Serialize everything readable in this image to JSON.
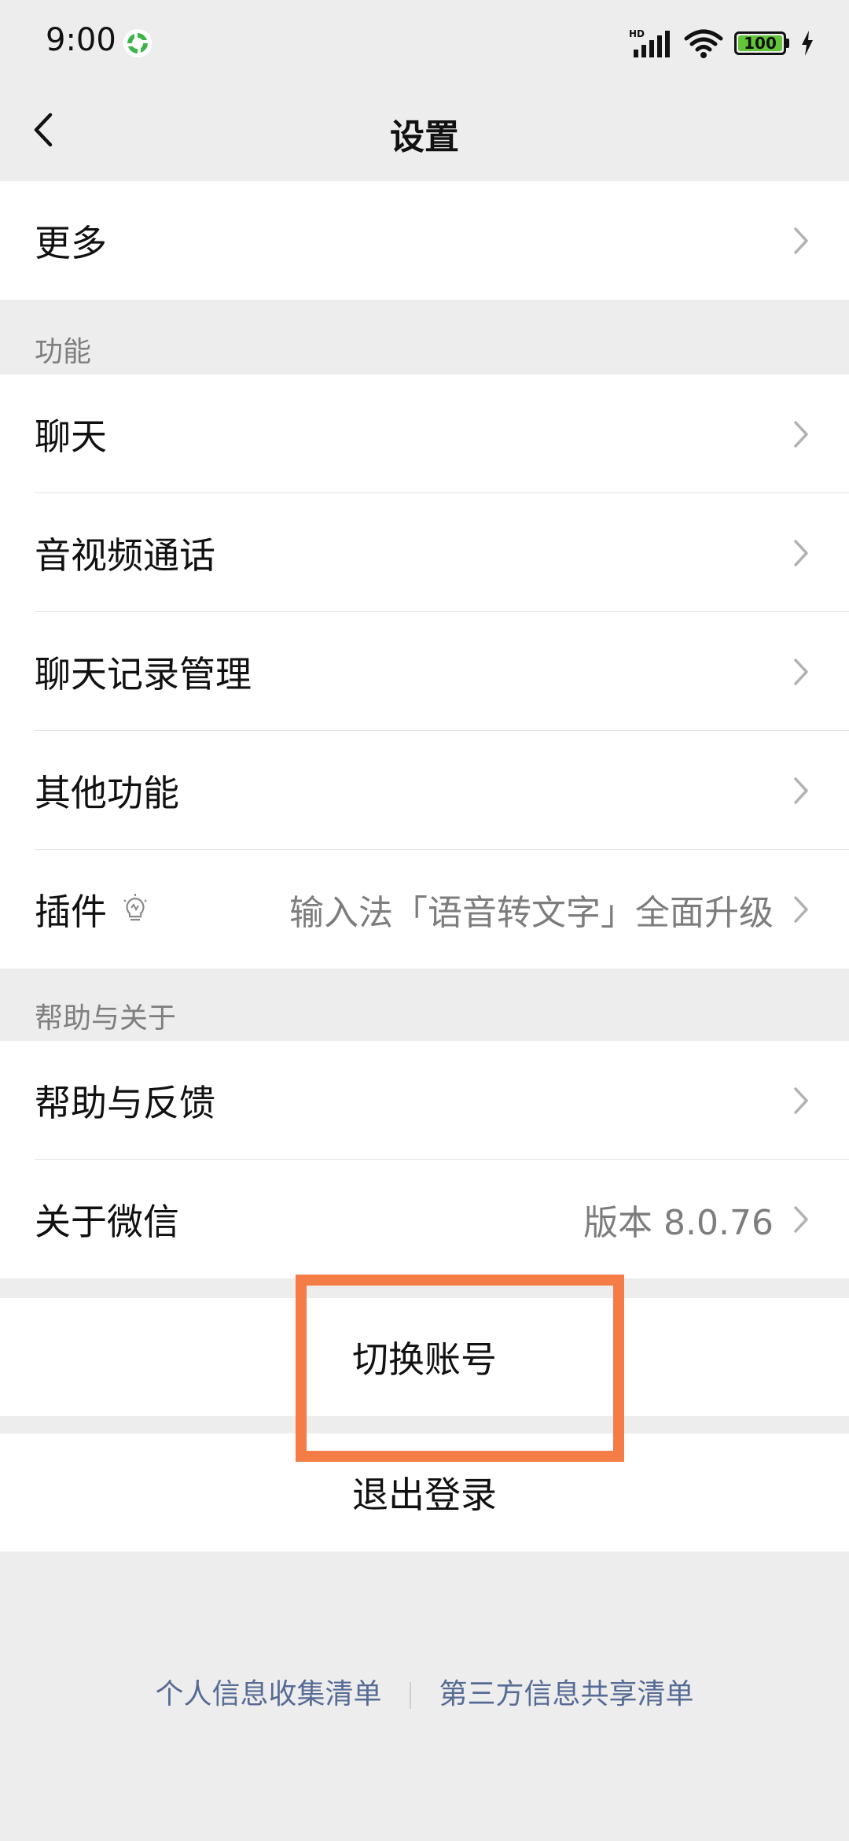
{
  "status_bar": {
    "time": "9:00",
    "network_badge": "HD",
    "battery_level": "100"
  },
  "nav": {
    "title": "设置"
  },
  "top_group": {
    "items": [
      {
        "label": "更多"
      }
    ]
  },
  "features": {
    "header": "功能",
    "items": [
      {
        "label": "聊天"
      },
      {
        "label": "音视频通话"
      },
      {
        "label": "聊天记录管理"
      },
      {
        "label": "其他功能"
      },
      {
        "label": "插件",
        "value": "输入法「语音转文字」全面升级"
      }
    ]
  },
  "help": {
    "header": "帮助与关于",
    "items": [
      {
        "label": "帮助与反馈"
      },
      {
        "label": "关于微信",
        "value": "版本 8.0.76"
      }
    ]
  },
  "actions": {
    "switch_account": "切换账号",
    "logout": "退出登录"
  },
  "footer": {
    "link_personal_info": "个人信息收集清单",
    "link_third_party": "第三方信息共享清单"
  },
  "colors": {
    "highlight": "#f47c46",
    "link": "#576b95",
    "battery": "#62c538"
  }
}
